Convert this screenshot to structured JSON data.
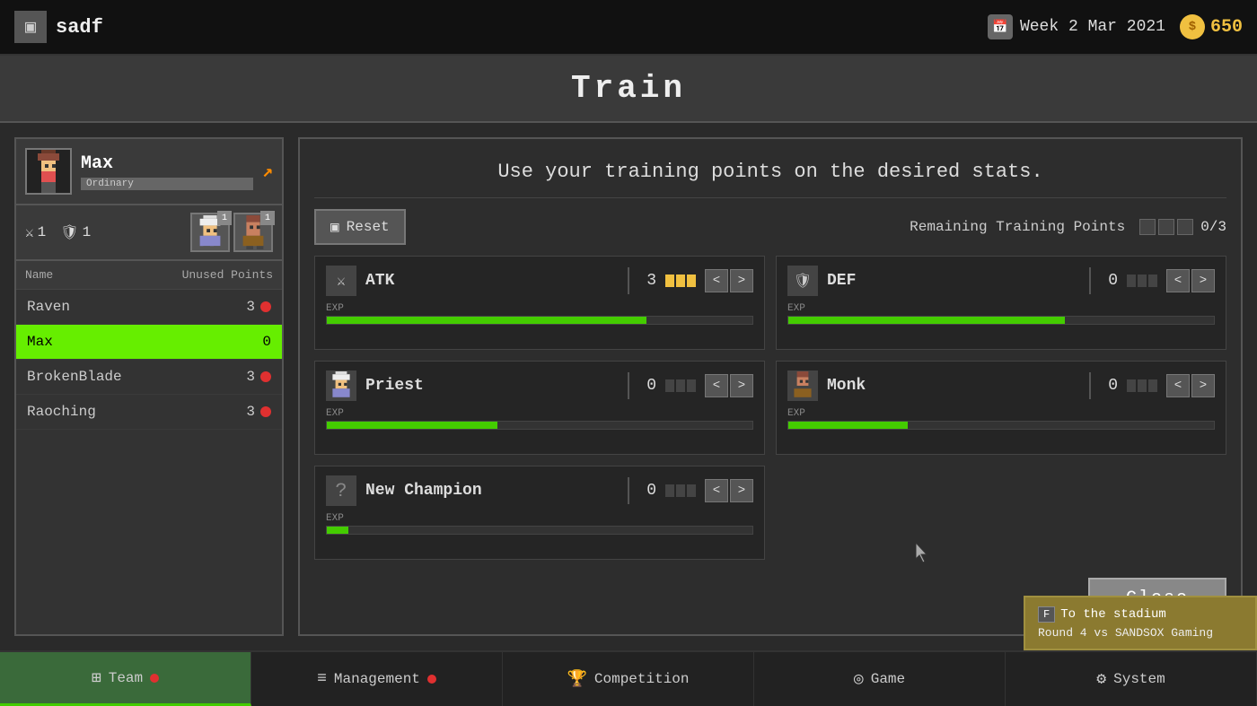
{
  "topbar": {
    "icon": "▣",
    "title": "sadf",
    "date_icon": "📅",
    "date": "Week 2 Mar 2021",
    "coins_icon": "●",
    "coins": "650"
  },
  "modal": {
    "title": "Train",
    "instruction": "Use your training points on the desired stats.",
    "reset_label": "Reset",
    "reset_icon": "▣",
    "remaining_label": "Remaining Training Points",
    "training_points": "0/3",
    "close_label": "Close"
  },
  "character": {
    "name": "Max",
    "rank": "Ordinary",
    "atk": "1",
    "def": "1",
    "arrow": "↗"
  },
  "roster": {
    "col_name": "Name",
    "col_points": "Unused Points",
    "items": [
      {
        "name": "Raven",
        "points": "3",
        "has_dot": true,
        "active": false
      },
      {
        "name": "Max",
        "points": "0",
        "has_dot": false,
        "active": true
      },
      {
        "name": "BrokenBlade",
        "points": "3",
        "has_dot": true,
        "active": false
      },
      {
        "name": "Raoching",
        "points": "3",
        "has_dot": true,
        "active": false
      }
    ]
  },
  "stats": [
    {
      "id": "atk",
      "icon": "⚔",
      "name": "ATK",
      "value": "3",
      "pips": 3,
      "exp_pct": 75
    },
    {
      "id": "def",
      "icon": "🛡",
      "name": "DEF",
      "value": "0",
      "pips": 0,
      "exp_pct": 65
    },
    {
      "id": "priest",
      "icon": "✦",
      "name": "Priest",
      "value": "0",
      "pips": 0,
      "exp_pct": 40
    },
    {
      "id": "monk",
      "icon": "☯",
      "name": "Monk",
      "value": "0",
      "pips": 0,
      "exp_pct": 28
    },
    {
      "id": "new_champion",
      "icon": "?",
      "name": "New Champion",
      "value": "0",
      "pips": 0,
      "exp_pct": 5
    }
  ],
  "nav": [
    {
      "id": "team",
      "icon": "⊞",
      "label": "Team",
      "active": true,
      "dot": true
    },
    {
      "id": "management",
      "icon": "≡",
      "label": "Management",
      "active": false,
      "dot": true
    },
    {
      "id": "competition",
      "icon": "🏆",
      "label": "Competition",
      "active": false,
      "dot": false
    },
    {
      "id": "game",
      "icon": "◎",
      "label": "Game",
      "active": false,
      "dot": false
    },
    {
      "id": "system",
      "icon": "⚙",
      "label": "System",
      "active": false,
      "dot": false
    }
  ],
  "stadium": {
    "key": "F",
    "title": "To the stadium",
    "subtitle": "Round 4 vs SANDSOX Gaming"
  }
}
